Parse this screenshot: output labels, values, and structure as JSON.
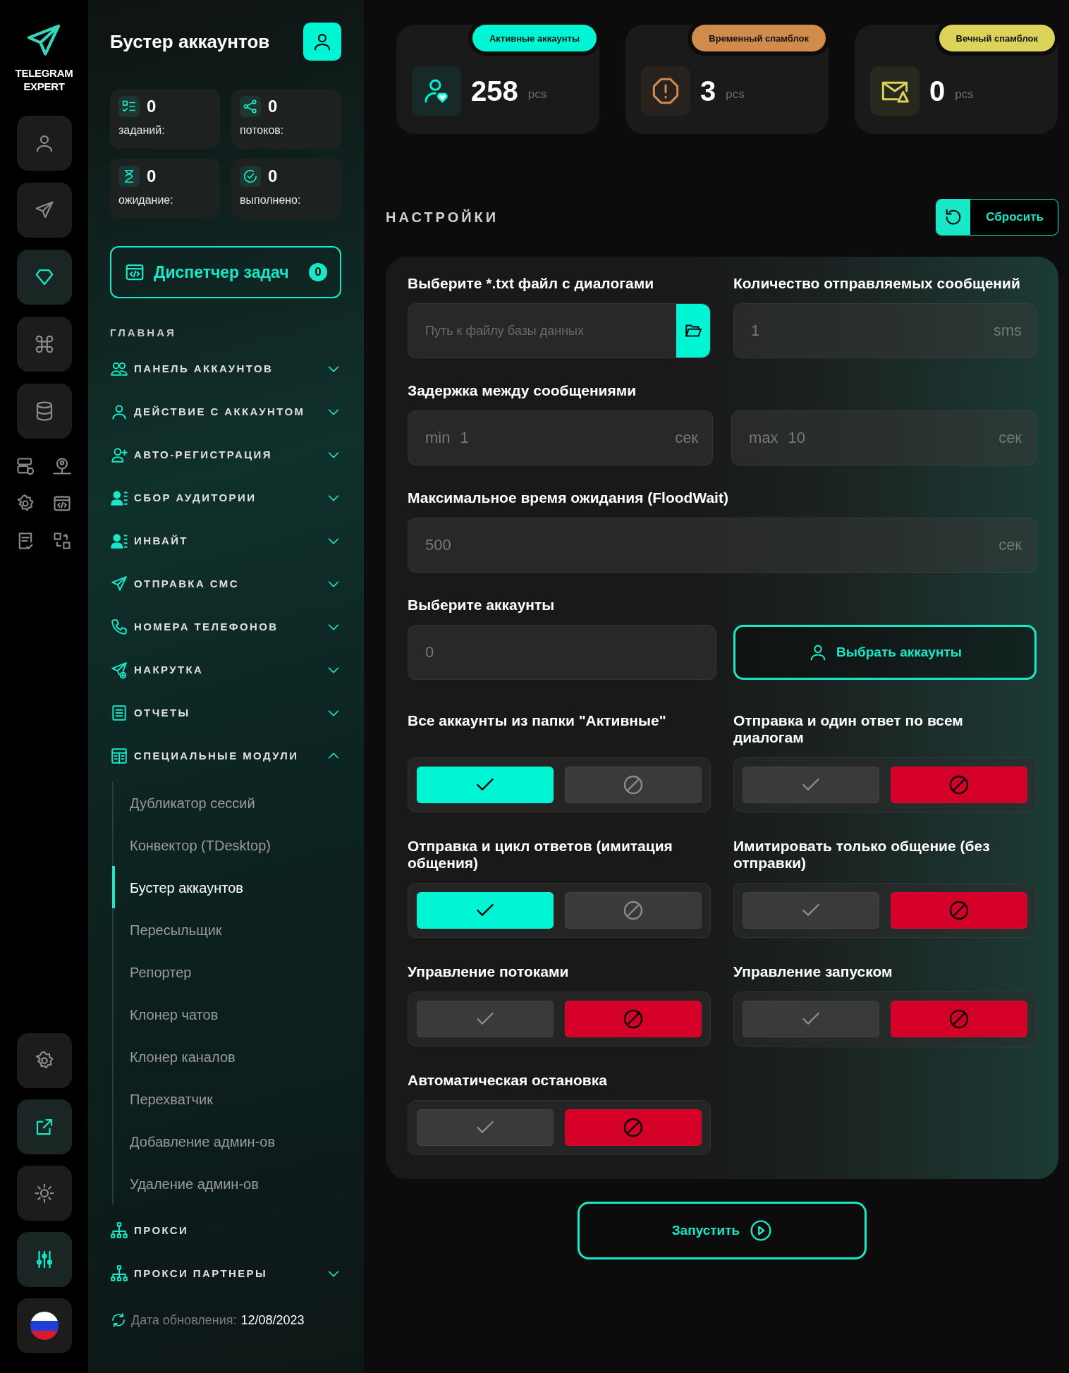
{
  "rail": {
    "logo": [
      "TELEGRAM",
      "EXPERT"
    ],
    "top": [
      {
        "active": false
      },
      {
        "active": false
      },
      {
        "active": true
      },
      {
        "active": false
      },
      {
        "active": false
      }
    ],
    "bottom": [
      {
        "active": false
      },
      {
        "active": true
      },
      {
        "active": false
      },
      {
        "active": true
      }
    ]
  },
  "sidebar": {
    "title": "Бустер аккаунтов",
    "stats": [
      {
        "value": "0",
        "label": "заданий:"
      },
      {
        "value": "0",
        "label": "потоков:"
      },
      {
        "value": "0",
        "label": "ожидание:"
      },
      {
        "value": "0",
        "label": "выполнено:"
      }
    ],
    "task_manager": {
      "label": "Диспетчер задач",
      "count": "0"
    },
    "section": "ГЛАВНАЯ",
    "nav": [
      {
        "kind": "group",
        "label": "ПАНЕЛЬ АККАУНТОВ",
        "expanded": false
      },
      {
        "kind": "group",
        "label": "ДЕЙСТВИЕ С АККАУНТОМ",
        "expanded": false
      },
      {
        "kind": "group",
        "label": "АВТО-РЕГИСТРАЦИЯ",
        "expanded": false
      },
      {
        "kind": "group",
        "label": "СБОР АУДИТОРИИ",
        "expanded": false
      },
      {
        "kind": "group",
        "label": "ИНВАЙТ",
        "expanded": false
      },
      {
        "kind": "group",
        "label": "ОТПРАВКА СМС",
        "expanded": false
      },
      {
        "kind": "group",
        "label": "НОМЕРА ТЕЛЕФОНОВ",
        "expanded": false
      },
      {
        "kind": "group",
        "label": "НАКРУТКА",
        "expanded": false
      },
      {
        "kind": "group",
        "label": "ОТЧЕТЫ",
        "expanded": false
      },
      {
        "kind": "group",
        "label": "СПЕЦИАЛЬНЫЕ МОДУЛИ",
        "expanded": true,
        "children": [
          {
            "label": "Дубликатор сессий",
            "selected": false
          },
          {
            "label": "Конвектор (TDesktop)",
            "selected": false
          },
          {
            "label": "Бустер аккаунтов",
            "selected": true
          },
          {
            "label": "Пересыльщик",
            "selected": false
          },
          {
            "label": "Репортер",
            "selected": false
          },
          {
            "label": "Клонер чатов",
            "selected": false
          },
          {
            "label": "Клонер каналов",
            "selected": false
          },
          {
            "label": "Перехватчик",
            "selected": false
          },
          {
            "label": "Добавление админ-ов",
            "selected": false
          },
          {
            "label": "Удаление админ-ов",
            "selected": false
          }
        ]
      },
      {
        "kind": "link",
        "label": "ПРОКСИ"
      },
      {
        "kind": "group",
        "label": "ПРОКСИ ПАРТНЕРЫ",
        "expanded": false
      }
    ],
    "updated": {
      "label": "Дата обновления:",
      "date": "12/08/2023"
    }
  },
  "stat_cards": [
    {
      "badge": "Активные аккаунты",
      "color": "#00f5d4",
      "value": "258",
      "unit": "pcs"
    },
    {
      "badge": "Временный спамблок",
      "color": "#d18c4c",
      "value": "3",
      "unit": "pcs"
    },
    {
      "badge": "Вечный спамблок",
      "color": "#dcd35a",
      "value": "0",
      "unit": "pcs"
    }
  ],
  "settings": {
    "title": "НАСТРОЙКИ",
    "reset": "Сбросить",
    "file": {
      "label": "Выберите *.txt файл с диалогами",
      "placeholder": "Путь к файлу базы данных"
    },
    "count": {
      "label": "Количество отправляемых сообщений",
      "placeholder": "1",
      "unit": "sms"
    },
    "delay": {
      "label": "Задержка между сообщениями",
      "min": {
        "prefix": "min",
        "placeholder": "1",
        "unit": "сек"
      },
      "max": {
        "prefix": "max",
        "placeholder": "10",
        "unit": "сек"
      }
    },
    "floodwait": {
      "label": "Максимальное время ожидания (FloodWait)",
      "placeholder": "500",
      "unit": "сек"
    },
    "accounts": {
      "label": "Выберите аккаунты",
      "placeholder": "0",
      "button": "Выбрать аккаунты"
    },
    "toggles": [
      {
        "label": "Все аккаунты из папки \"Активные\"",
        "on": true
      },
      {
        "label": "Отправка и один ответ по всем диалогам",
        "on": false
      },
      {
        "label": "Отправка и цикл ответов (имитация общения)",
        "on": true
      },
      {
        "label": "Имитировать только общение (без отправки)",
        "on": false
      },
      {
        "label": "Управление потоками",
        "on": false
      },
      {
        "label": "Управление запуском",
        "on": false
      },
      {
        "label": "Автоматическая остановка",
        "on": false
      }
    ],
    "start": "Запустить"
  }
}
